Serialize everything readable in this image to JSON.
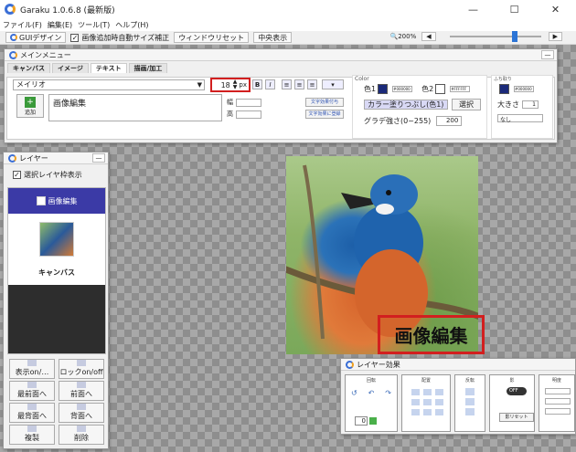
{
  "window": {
    "title": "Garaku 1.0.6.8 (最新版)",
    "minimize": "—",
    "maximize": "☐",
    "close": "✕"
  },
  "menu": [
    "ファイル(F)",
    "編集(E)",
    "ツール(T)",
    "ヘルプ(H)"
  ],
  "toolbar": {
    "gui_design": "GUIデザイン",
    "auto_resize": "画像追加時自動サイズ補正",
    "auto_resize_checked": true,
    "window_reset": "ウィンドウリセット",
    "center_view": "中央表示",
    "zoom_label": "200%"
  },
  "main_menu": {
    "title": "メインメニュー",
    "tabs": [
      "キャンバス",
      "イメージ",
      "テキスト",
      "描画/加工"
    ],
    "active_tab": 2,
    "font_name": "メイリオ",
    "font_size": "18",
    "font_unit": "px",
    "bold": "B",
    "italic": "I",
    "add_label": "追加",
    "text_value": "画像編集",
    "row1_label": "幅",
    "row2_label": "高",
    "effect1": "文字効果付与",
    "effect2": "文字効果に登録",
    "color": {
      "group_label": "Color",
      "color1": "色1",
      "color1_hex": "#000000",
      "color2": "色2",
      "color2_hex": "#FFFFFF",
      "fill_mode": "カラー塗りつぶし(色1)",
      "select_btn": "選択",
      "gradient_label": "グラデ強さ(0~255)",
      "gradient_value": "200"
    },
    "border": {
      "group_label": "ふち取り",
      "hex": "#000000",
      "size_label": "大きさ",
      "size_value": "1",
      "mode": "なし"
    }
  },
  "layer_panel": {
    "title": "レイヤー",
    "show_frame": "選択レイヤ枠表示",
    "show_frame_checked": true,
    "layers": [
      {
        "name": "画像編集",
        "type": "text",
        "selected": true
      },
      {
        "name": "キャンバス",
        "type": "image",
        "selected": false
      }
    ],
    "buttons": [
      "表示on/…",
      "ロックon/off",
      "最前面へ",
      "前面へ",
      "最背面へ",
      "背面へ",
      "複製",
      "削除"
    ]
  },
  "canvas": {
    "overlay_text": "画像編集"
  },
  "effect_panel": {
    "title": "レイヤー効果",
    "sections": [
      "回転",
      "配置",
      "反転",
      "影",
      "明度"
    ],
    "rotate_value": "0",
    "toggle": "OFF",
    "reset": "影リセット"
  }
}
